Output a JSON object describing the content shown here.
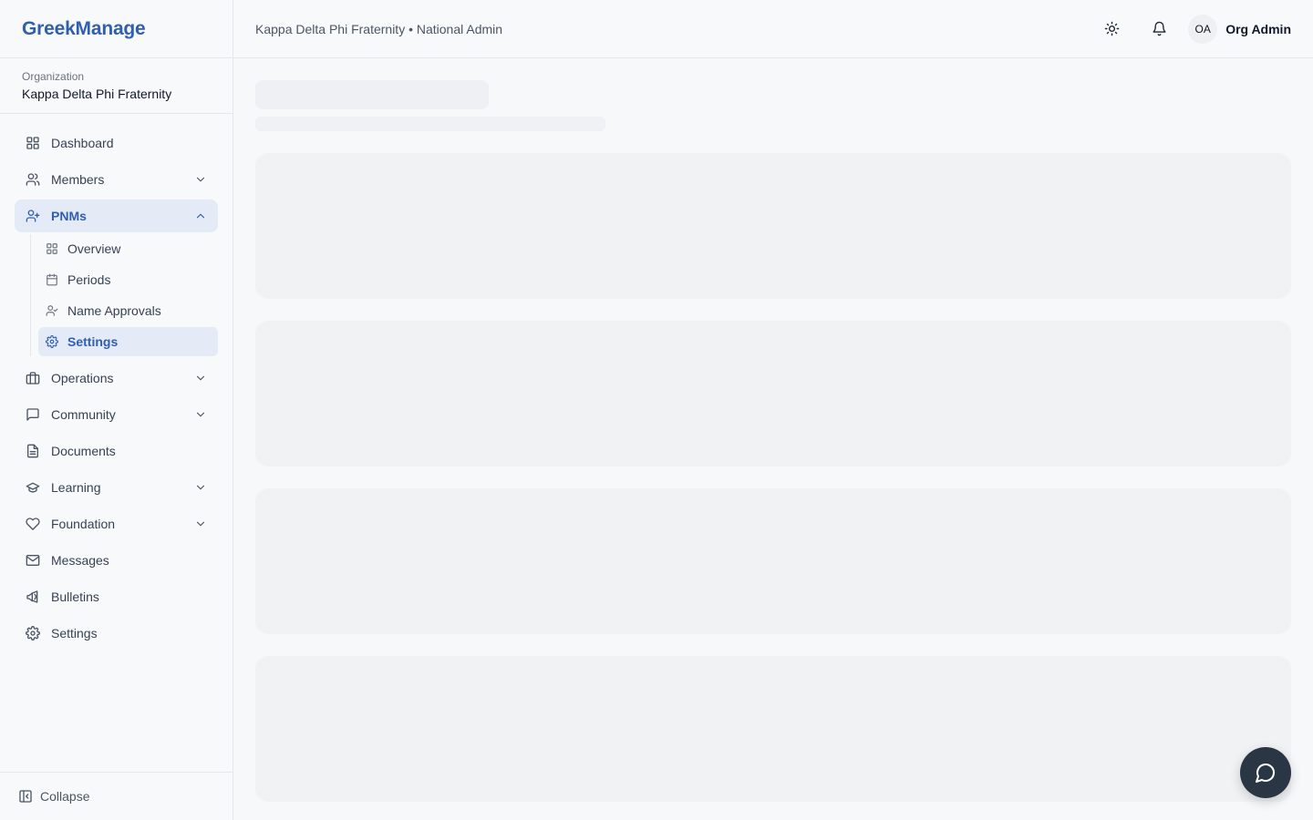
{
  "brand": {
    "name": "GreekManage"
  },
  "organization": {
    "label": "Organization",
    "name": "Kappa Delta Phi Fraternity"
  },
  "nav": {
    "dashboard": "Dashboard",
    "members": "Members",
    "pnms": "PNMs",
    "pnms_sub": {
      "overview": "Overview",
      "periods": "Periods",
      "name_approvals": "Name Approvals",
      "settings": "Settings"
    },
    "operations": "Operations",
    "community": "Community",
    "documents": "Documents",
    "learning": "Learning",
    "foundation": "Foundation",
    "messages": "Messages",
    "bulletins": "Bulletins",
    "settings": "Settings"
  },
  "collapse_label": "Collapse",
  "topbar": {
    "breadcrumb": "Kappa Delta Phi Fraternity • National Admin",
    "user_initials": "OA",
    "user_name": "Org Admin"
  },
  "colors": {
    "accent": "#2f5fad",
    "active_bg": "#e4ebf6",
    "fab_bg": "#2b3645"
  },
  "icons": {
    "dashboard": "grid-icon",
    "members": "users-icon",
    "pnms": "user-plus-icon",
    "operations": "briefcase-icon",
    "community": "message-square-icon",
    "documents": "file-text-icon",
    "learning": "graduation-cap-icon",
    "foundation": "heart-icon",
    "messages": "mail-icon",
    "bulletins": "megaphone-icon",
    "settings": "gear-icon",
    "theme": "sun-icon",
    "notifications": "bell-icon",
    "chat": "chat-bubble-icon"
  }
}
